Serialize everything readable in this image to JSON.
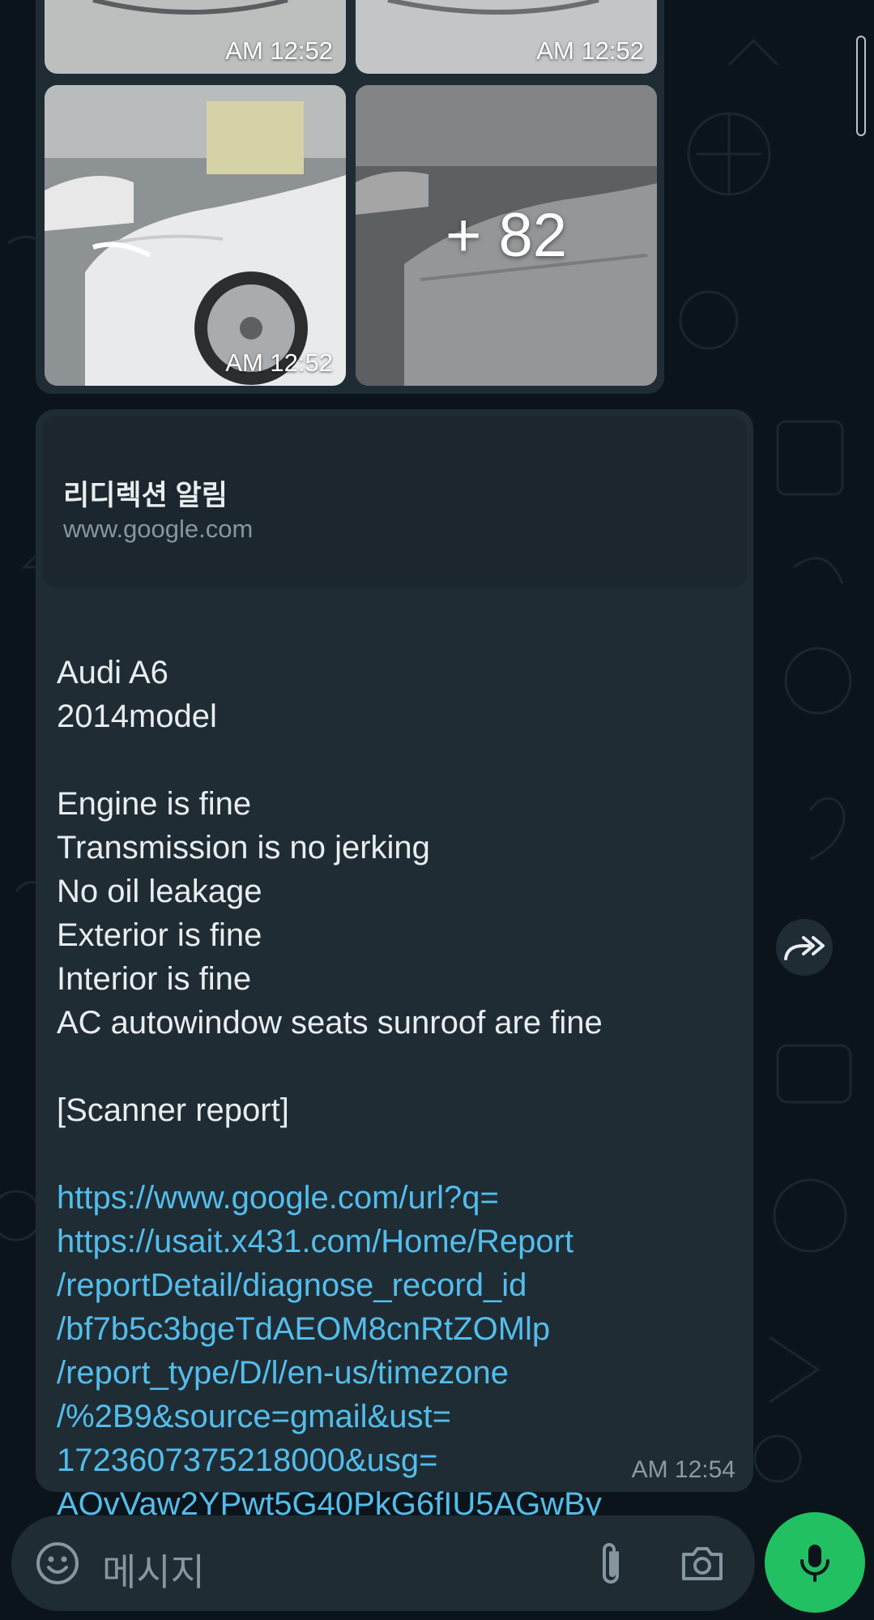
{
  "album": {
    "tiles": [
      {
        "time": "AM 12:52"
      },
      {
        "time": "AM 12:52"
      },
      {
        "time": "AM 12:52"
      },
      {
        "more": "+ 82"
      }
    ]
  },
  "message": {
    "link_preview": {
      "title": "리디렉션 알림",
      "domain": "www.google.com"
    },
    "body": "Audi A6\n2014model\n\nEngine is fine\nTransmission is no jerking\nNo oil leakage\nExterior is fine\nInterior is fine\nAC autowindow seats sunroof are fine\n\n[Scanner report]",
    "link": "https://www.google.com/url?q=\nhttps://usait.x431.com/Home/Report\n/reportDetail/diagnose_record_id\n/bf7b5c3bgeTdAEOM8cnRtZOMlp\n/report_type/D/l/en-us/timezone\n/%2B9&source=gmail&ust=\n1723607375218000&usg=\nAOvVaw2YPwt5G40PkG6fIU5AGwBy",
    "time": "AM 12:54"
  },
  "composer": {
    "placeholder": "메시지"
  },
  "icons": {
    "emoji": "emoji-icon",
    "attach": "paperclip-icon",
    "camera": "camera-icon",
    "mic": "mic-icon",
    "forward": "forward-icon"
  },
  "colors": {
    "background": "#0b141a",
    "bubble": "#1f2c34",
    "link": "#53bdeb",
    "accent": "#21c063"
  }
}
